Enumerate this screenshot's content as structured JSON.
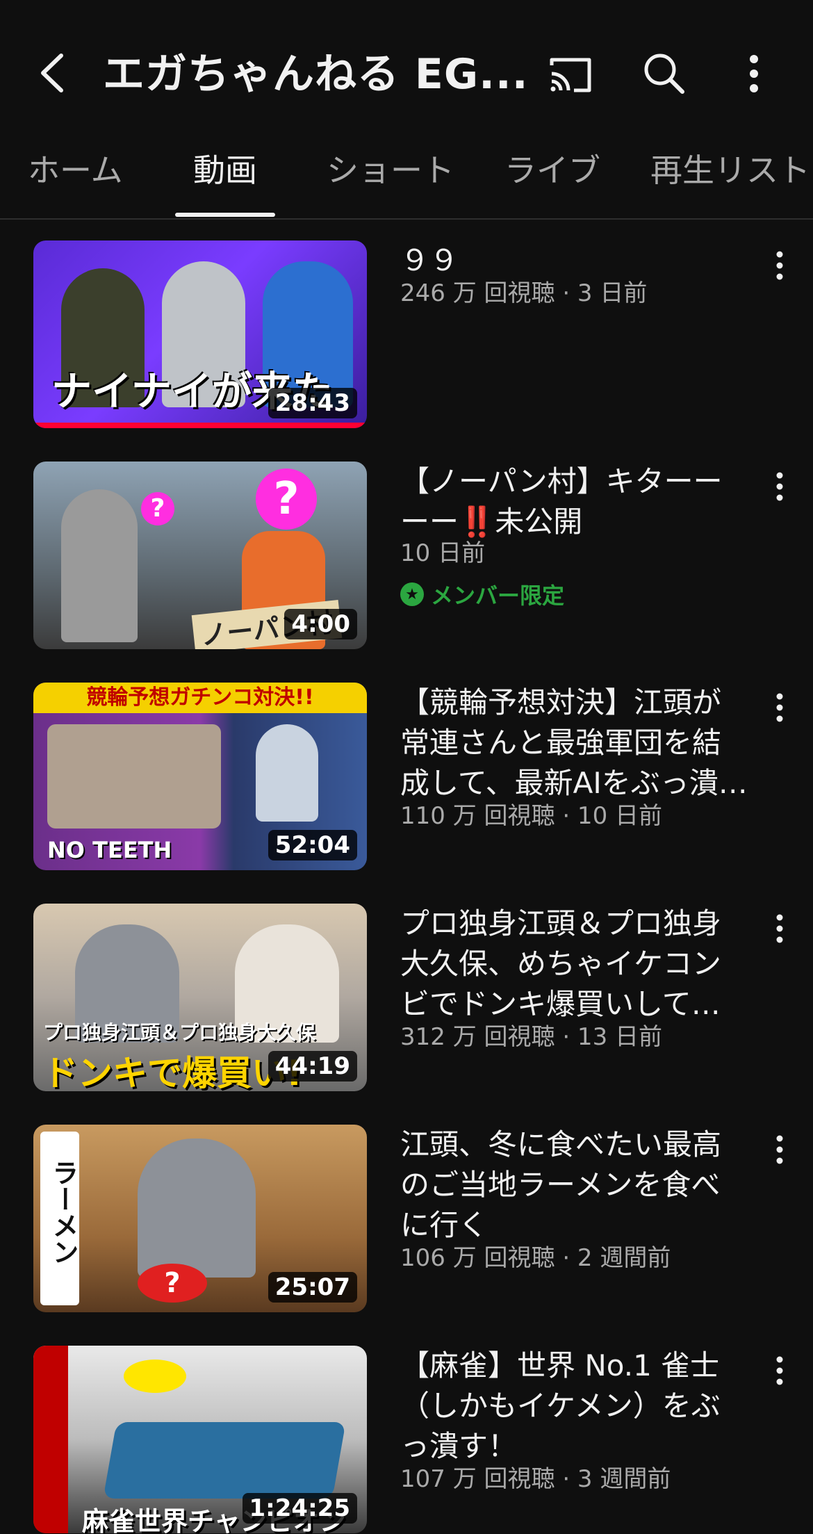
{
  "header": {
    "channel_title": "エガちゃんねる EG..."
  },
  "tabs": [
    {
      "label": "ホーム"
    },
    {
      "label": "動画"
    },
    {
      "label": "ショート"
    },
    {
      "label": "ライブ"
    },
    {
      "label": "再生リスト"
    }
  ],
  "active_tab": "動画",
  "videos": [
    {
      "title": "９９",
      "meta": "246 万 回視聴 · 3 日前",
      "duration": "28:43",
      "thumb_caption": "ナイナイが来た",
      "watched_fraction": 1.0
    },
    {
      "title": "【ノーパン村】キターーーー‼️未公開",
      "meta": "10 日前",
      "duration": "4:00",
      "badge": "メンバー限定",
      "thumb_caption": "ノーパン村"
    },
    {
      "title": "【競輪予想対決】江頭が常連さんと最強軍団を結成して、最新AIをぶっ潰…",
      "meta": "110 万 回視聴 · 10 日前",
      "duration": "52:04",
      "thumb_caption_top": "競輪予想ガチンコ対決!!",
      "thumb_caption_bottom": "NO TEETH"
    },
    {
      "title": "プロ独身江頭＆プロ独身大久保、めちゃイケコンビでドンキ爆買いして…",
      "meta": "312 万 回視聴 · 13 日前",
      "duration": "44:19",
      "thumb_caption_top": "プロ独身江頭＆プロ独身大久保",
      "thumb_caption_bottom": "ドンキで爆買い!"
    },
    {
      "title": "江頭、冬に食べたい最高のご当地ラーメンを食べに行く",
      "meta": "106 万 回視聴 · 2 週間前",
      "duration": "25:07",
      "thumb_caption": "ラーメン"
    },
    {
      "title": "【麻雀】世界 No.1 雀士（しかもイケメン）をぶっ潰す！",
      "meta": "107 万 回視聴 · 3 週間前",
      "duration": "1:24:25",
      "thumb_caption": "麻雀世界チャンピオン"
    }
  ],
  "colors": {
    "background": "#0f0f0f",
    "progress": "#ff0033",
    "member": "#2ba640"
  }
}
